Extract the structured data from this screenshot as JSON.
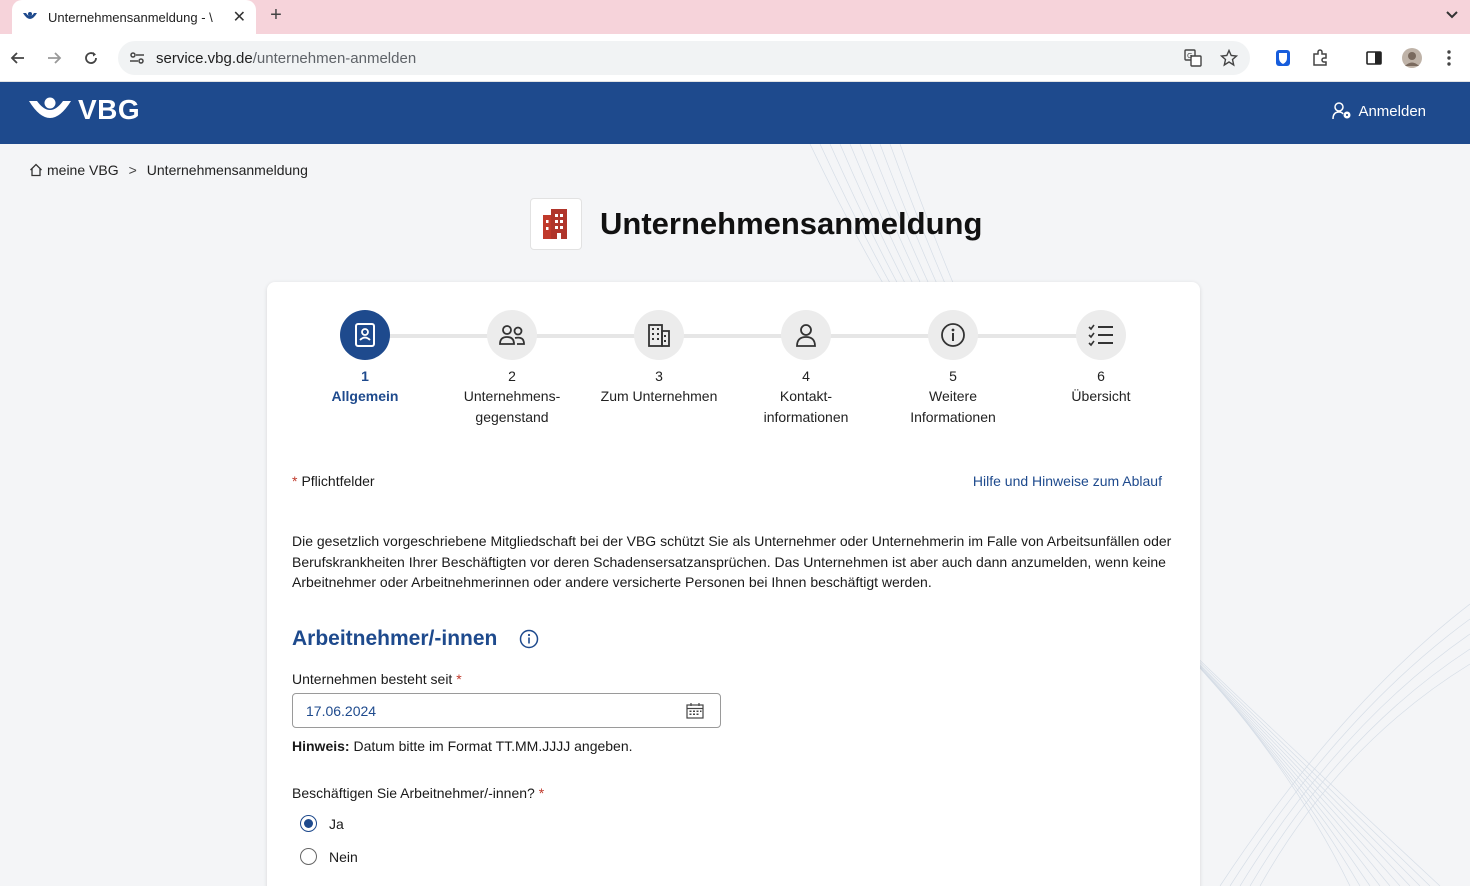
{
  "browser": {
    "tab_title": "Unternehmensanmeldung - \\",
    "url_host": "service.vbg.de",
    "url_path": "/unternehmen-anmelden",
    "new_tab_label": "+",
    "tab_close_label": "✕"
  },
  "site": {
    "brand": "VBG",
    "login_label": "Anmelden"
  },
  "breadcrumb": {
    "home": "meine VBG",
    "separator": ">",
    "current": "Unternehmensanmeldung"
  },
  "page": {
    "title": "Unternehmensanmeldung"
  },
  "steps": [
    {
      "number": "1",
      "label": "Allgemein",
      "active": true,
      "icon": "id-card-icon"
    },
    {
      "number": "2",
      "label": "Unternehmens-\ngegenstand",
      "active": false,
      "icon": "people-icon"
    },
    {
      "number": "3",
      "label": "Zum Unternehmen",
      "active": false,
      "icon": "building-icon"
    },
    {
      "number": "4",
      "label": "Kontakt-\ninformationen",
      "active": false,
      "icon": "person-icon"
    },
    {
      "number": "5",
      "label": "Weitere\nInformationen",
      "active": false,
      "icon": "info-icon"
    },
    {
      "number": "6",
      "label": "Übersicht",
      "active": false,
      "icon": "checklist-icon"
    }
  ],
  "form": {
    "required_marker": "*",
    "required_note": "Pflichtfelder",
    "help_link": "Hilfe und Hinweise zum Ablauf",
    "intro": "Die gesetzlich vorgeschriebene Mitgliedschaft bei der VBG schützt Sie als Unternehmer oder Unternehmerin im Falle von Arbeitsunfällen oder Berufskrankheiten Ihrer Beschäftigten vor deren Schadensersatzansprüchen. Das Unternehmen ist aber auch dann anzumelden, wenn keine Arbeitnehmer oder Arbeitnehmerinnen oder andere versicherte Personen bei Ihnen beschäftigt werden.",
    "section_title": "Arbeitnehmer/-innen",
    "date_label": "Unternehmen besteht seit",
    "date_value": "17.06.2024",
    "hint_bold": "Hinweis:",
    "hint_text": " Datum bitte im Format TT.MM.JJJJ angeben.",
    "question": "Beschäftigen Sie Arbeitnehmer/-innen?",
    "options": [
      {
        "label": "Ja",
        "checked": true
      },
      {
        "label": "Nein",
        "checked": false
      }
    ]
  },
  "colors": {
    "brand_blue": "#1e4a8d",
    "required_red": "#c0392b",
    "tab_strip": "#f6d3da"
  }
}
